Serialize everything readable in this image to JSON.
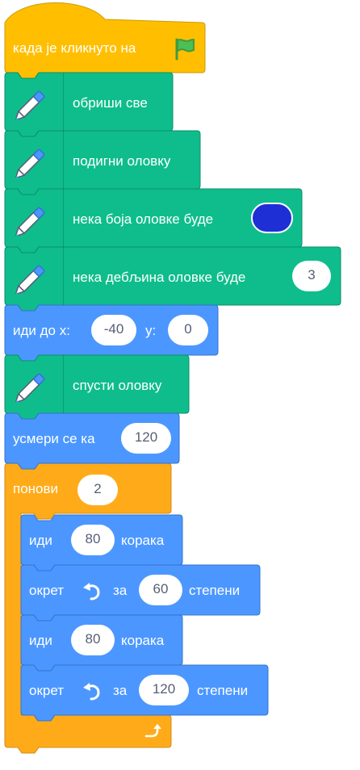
{
  "colors": {
    "events": "#ffbf00",
    "events_border": "#cc9900",
    "pen": "#0fbd8c",
    "pen_border": "#0b8e69",
    "motion": "#4c97ff",
    "motion_border": "#3373cc",
    "control": "#ffab19",
    "control_border": "#cf8b17",
    "pen_color_value": "#1f2fd6"
  },
  "blocks": {
    "when_flag": {
      "text": "када је кликнуто на",
      "icon": "green-flag-icon"
    },
    "clear": {
      "text": "обриши све",
      "icon": "pen-icon"
    },
    "pen_up": {
      "text": "подигни оловку",
      "icon": "pen-icon"
    },
    "set_color": {
      "text": "нека боја оловке буде",
      "icon": "pen-icon"
    },
    "set_size": {
      "text": "нека дебљина оловке буде",
      "value": "3",
      "icon": "pen-icon"
    },
    "goto": {
      "text_x": "иди до x:",
      "x": "-40",
      "text_y": "y:",
      "y": "0"
    },
    "pen_down": {
      "text": "спусти оловку",
      "icon": "pen-icon"
    },
    "point": {
      "text": "усмери се ка",
      "value": "120"
    },
    "repeat": {
      "text": "понови",
      "value": "2",
      "icon": "repeat-arrow-icon"
    },
    "move1": {
      "text_a": "иди",
      "value": "80",
      "text_b": "корака"
    },
    "turn1": {
      "text_a": "окрет",
      "text_b": "за",
      "value": "60",
      "text_c": "степени",
      "icon": "rotate-left-icon"
    },
    "move2": {
      "text_a": "иди",
      "value": "80",
      "text_b": "корака"
    },
    "turn2": {
      "text_a": "окрет",
      "text_b": "за",
      "value": "120",
      "text_c": "степени",
      "icon": "rotate-left-icon"
    }
  }
}
